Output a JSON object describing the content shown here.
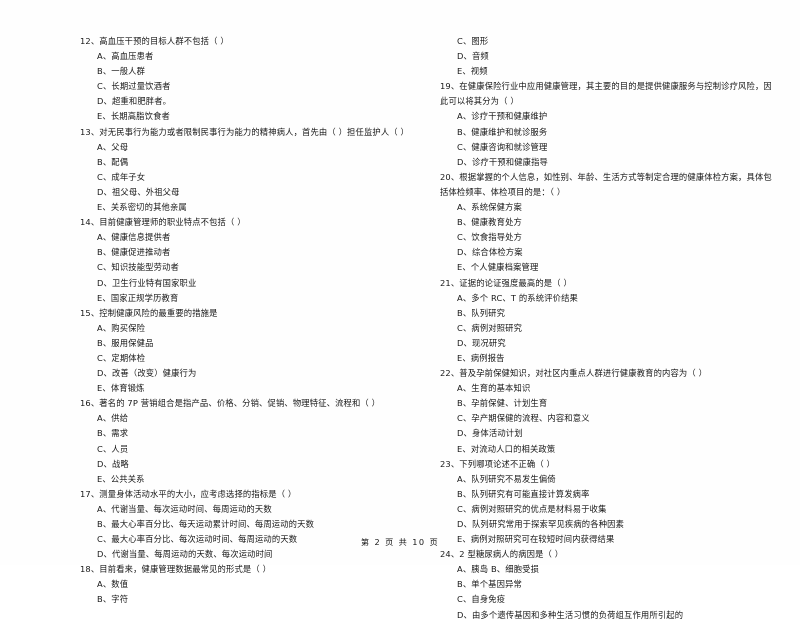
{
  "document": {
    "page_footer": "第 2 页  共 10 页"
  },
  "left_column": [
    {
      "stem": "12、高血压干预的目标人群不包括（      ）",
      "options": [
        "A、高血压患者",
        "B、一般人群",
        "C、长期过量饮酒者",
        "D、超重和肥胖者。",
        "E、长期高脂饮食者"
      ]
    },
    {
      "stem": "13、对无民事行为能力或者限制民事行为能力的精神病人，首先由（          ）担任监护人（      ）",
      "options": [
        "A、父母",
        "B、配偶",
        "C、成年子女",
        "D、祖父母、外祖父母",
        "E、关系密切的其他亲属"
      ]
    },
    {
      "stem": "14、目前健康管理师的职业特点不包括（      ）",
      "options": [
        "A、健康信息提供者",
        "B、健康促进推动者",
        "C、知识技能型劳动者",
        "D、卫生行业特有国家职业",
        "E、国家正规学历教育"
      ]
    },
    {
      "stem": "15、控制健康风险的最重要的措施是",
      "options": [
        "A、购买保险",
        "B、服用保健品",
        "C、定期体检",
        "D、改善（改变）健康行为",
        "E、体育锻炼"
      ]
    },
    {
      "stem": "16、著名的 7P 营销组合是指产品、价格、分销、促销、物理特征、流程和（      ）",
      "options": [
        "A、供给",
        "B、需求",
        "C、人员",
        "D、战略",
        "E、公共关系"
      ]
    },
    {
      "stem": "17、测量身体活动水平的大小，应考虑选择的指标是（      ）",
      "options": [
        "A、代谢当量、每次运动时间、每周运动的天数",
        "B、最大心率百分比、每天运动累计时间、每周运动的天数",
        "C、最大心率百分比、每次运动时间、每周运动的天数",
        "D、代谢当量、每周运动的天数、每次运动时间"
      ]
    },
    {
      "stem": "18、目前看来，健康管理数据最常见的形式是（      ）",
      "options": [
        "A、数值",
        "B、字符"
      ]
    }
  ],
  "right_column": [
    {
      "stem": "",
      "options": [
        "C、图形",
        "D、音频",
        "E、视频"
      ]
    },
    {
      "stem": "19、在健康保险行业中应用健康管理，其主要的目的是提供健康服务与控制诊疗风险，因此可以将其分为（      ）",
      "options": [
        "A、诊疗干预和健康维护",
        "B、健康维护和就诊服务",
        "C、健康咨询和就诊管理",
        "D、诊疗干预和健康指导"
      ]
    },
    {
      "stem": "20、根据掌握的个人信息，如性别、年龄、生活方式等制定合理的健康体检方案，具体包括体检频率、体检项目的是：（      ）",
      "options": [
        "A、系统保健方案",
        "B、健康教育处方",
        "C、饮食指导处方",
        "D、综合体检方案",
        "E、个人健康档案管理"
      ]
    },
    {
      "stem": "21、证据的论证强度最高的是（      ）",
      "options": [
        "A、多个 RC、T 的系统评价结果",
        "B、队列研究",
        "C、病例对照研究",
        "D、现况研究",
        "E、病例报告"
      ]
    },
    {
      "stem": "22、普及孕前保健知识，对社区内重点人群进行健康教育的内容为（      ）",
      "options": [
        "A、生育的基本知识",
        "B、孕前保健、计划生育",
        "C、孕产期保健的流程、内容和意义",
        "D、身体活动计划",
        "E、对流动人口的相关政策"
      ]
    },
    {
      "stem": "23、下列哪项论述不正确（      ）",
      "options": [
        "A、队列研究不易发生偏倚",
        "B、队列研究有可能直接计算发病率",
        "C、病例对照研究的优点是材料易于收集",
        "D、队列研究常用于探索罕见疾病的各种因素",
        "E、病例对照研究可在较短时间内获得结果"
      ]
    },
    {
      "stem": "24、2 型糖尿病人的病因是（      ）",
      "options": [
        "A、胰岛 B、细胞受损",
        "B、单个基因异常",
        "C、自身免疫",
        "D、由多个遗传基因和多种生活习惯的负荷组互作用所引起的"
      ]
    }
  ]
}
